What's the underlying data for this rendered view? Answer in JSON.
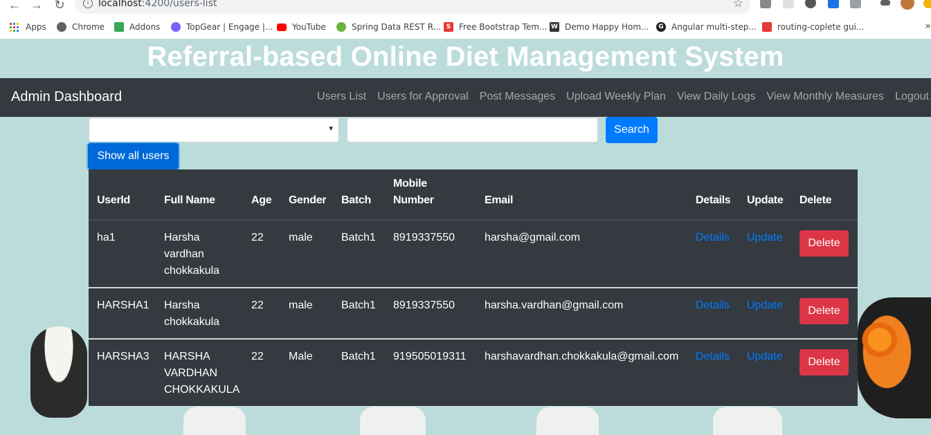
{
  "browser": {
    "url_host": "localhost",
    "url_path": ":4200/users-list",
    "bookmarks": [
      {
        "label": "Apps",
        "icon": "apps-grid-icon",
        "color": "#4285f4"
      },
      {
        "label": "Chrome",
        "icon": "globe-icon",
        "color": "#5f6368"
      },
      {
        "label": "Addons",
        "icon": "puzzle-icon",
        "color": "#34a853"
      },
      {
        "label": "TopGear | Engage |...",
        "icon": "topgear-icon",
        "color": "#7b61ff"
      },
      {
        "label": "YouTube",
        "icon": "youtube-icon",
        "color": "#ff0000"
      },
      {
        "label": "Spring Data REST R...",
        "icon": "spring-icon",
        "color": "#6db33f"
      },
      {
        "label": "Free Bootstrap Tem...",
        "icon": "s-logo-icon",
        "color": "#e53935"
      },
      {
        "label": "Demo Happy Hom...",
        "icon": "w3-icon",
        "color": "#333333"
      },
      {
        "label": "Angular multi-step...",
        "icon": "g-logo-icon",
        "color": "#202124"
      },
      {
        "label": "routing-coplete gui...",
        "icon": "bookmark-page-icon",
        "color": "#e53935"
      }
    ],
    "more_label": "»"
  },
  "site_title": "Referral-based Online Diet Management System",
  "navbar": {
    "brand": "Admin Dashboard",
    "links": [
      "Users List",
      "Users for Approval",
      "Post Messages",
      "Upload Weekly Plan",
      "View Daily Logs",
      "View Monthly Measures",
      "Logout"
    ]
  },
  "filter": {
    "select_value": "",
    "search_value": "",
    "search_label": "Search",
    "show_all_label": "Show all users"
  },
  "table": {
    "headers": [
      "UserId",
      "Full Name",
      "Age",
      "Gender",
      "Batch",
      "Mobile Number",
      "Email",
      "Details",
      "Update",
      "Delete"
    ],
    "rows": [
      {
        "userid": "ha1",
        "fullname_lines": [
          "Harsha",
          "vardhan",
          "chokkakula"
        ],
        "age": "22",
        "gender": "male",
        "batch": "Batch1",
        "mobile": "8919337550",
        "email": "harsha@gmail.com",
        "details": "Details",
        "update": "Update",
        "delete": "Delete"
      },
      {
        "userid": "HARSHA1",
        "fullname_lines": [
          "Harsha",
          "chokkakula"
        ],
        "age": "22",
        "gender": "male",
        "batch": "Batch1",
        "mobile": "8919337550",
        "email": "harsha.vardhan@gmail.com",
        "details": "Details",
        "update": "Update",
        "delete": "Delete"
      },
      {
        "userid": "HARSHA3",
        "fullname_lines": [
          "HARSHA",
          "VARDHAN",
          "CHOKKAKULA"
        ],
        "age": "22",
        "gender": "Male",
        "batch": "Batch1",
        "mobile": "919505019311",
        "email": "harshavardhan.chokkakula@gmail.com",
        "details": "Details",
        "update": "Update",
        "delete": "Delete"
      }
    ]
  },
  "colors": {
    "page_bg": "#bcdcdb",
    "navbar_bg": "#343a40",
    "primary": "#007bff",
    "danger": "#dc3545"
  }
}
